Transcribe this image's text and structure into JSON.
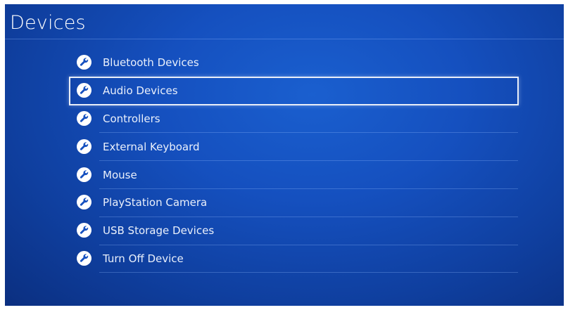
{
  "header": {
    "title": "Devices"
  },
  "menu": {
    "items": [
      {
        "label": "Bluetooth Devices",
        "icon": "wrench-icon"
      },
      {
        "label": "Audio Devices",
        "icon": "wrench-icon",
        "selected": true
      },
      {
        "label": "Controllers",
        "icon": "wrench-icon"
      },
      {
        "label": "External Keyboard",
        "icon": "wrench-icon"
      },
      {
        "label": "Mouse",
        "icon": "wrench-icon"
      },
      {
        "label": "PlayStation Camera",
        "icon": "wrench-icon"
      },
      {
        "label": "USB Storage Devices",
        "icon": "wrench-icon"
      },
      {
        "label": "Turn Off Device",
        "icon": "wrench-icon"
      }
    ]
  },
  "colors": {
    "background": "#1550bf",
    "text": "#eaf0fb",
    "selection_border": "#e9eef8"
  }
}
